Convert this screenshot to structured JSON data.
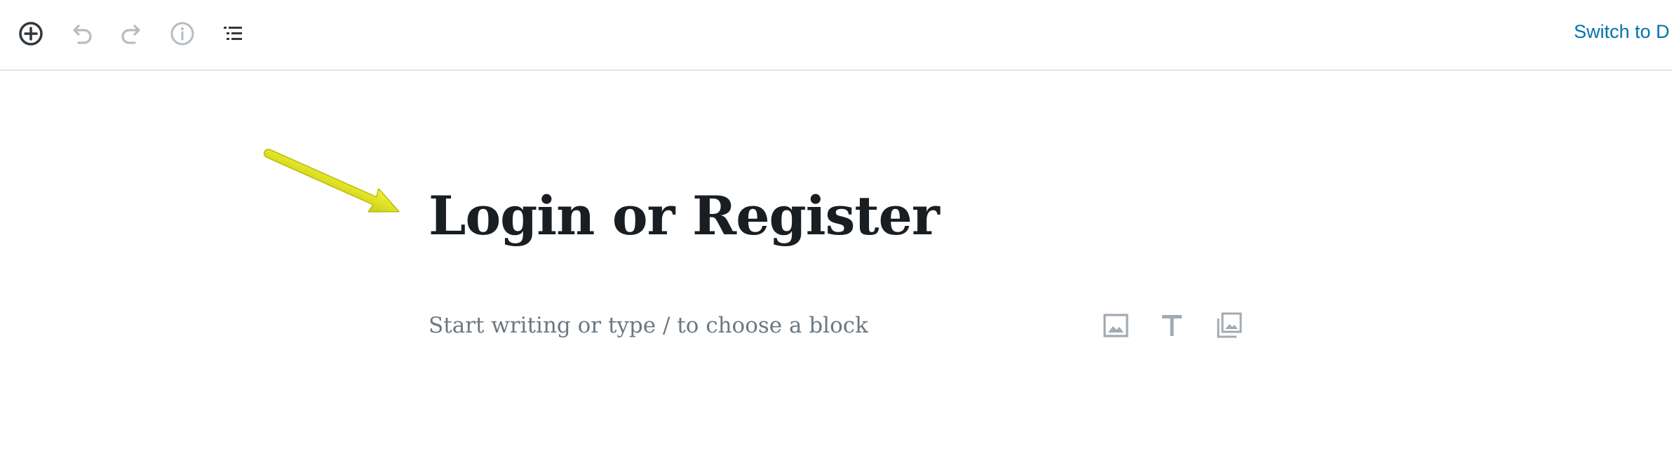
{
  "toolbar": {
    "icons": {
      "add": "plus-circle-icon",
      "undo": "undo-icon",
      "redo": "redo-icon",
      "info": "info-icon",
      "outline": "list-view-icon"
    },
    "switch_label": "Switch to D"
  },
  "editor": {
    "title": "Login or Register",
    "placeholder": "Start writing or type / to choose a block"
  },
  "quick_inserter": {
    "icons": [
      "image-icon",
      "heading-icon",
      "gallery-icon"
    ]
  },
  "annotation": {
    "arrow_icon": "yellow-arrow-icon",
    "arrow_color": "#e8ea1a"
  },
  "colors": {
    "link": "#0073aa",
    "title": "#191e23",
    "placeholder": "#6c7781",
    "icon_active": "#555d66",
    "icon_disabled": "#b5bcc2"
  }
}
